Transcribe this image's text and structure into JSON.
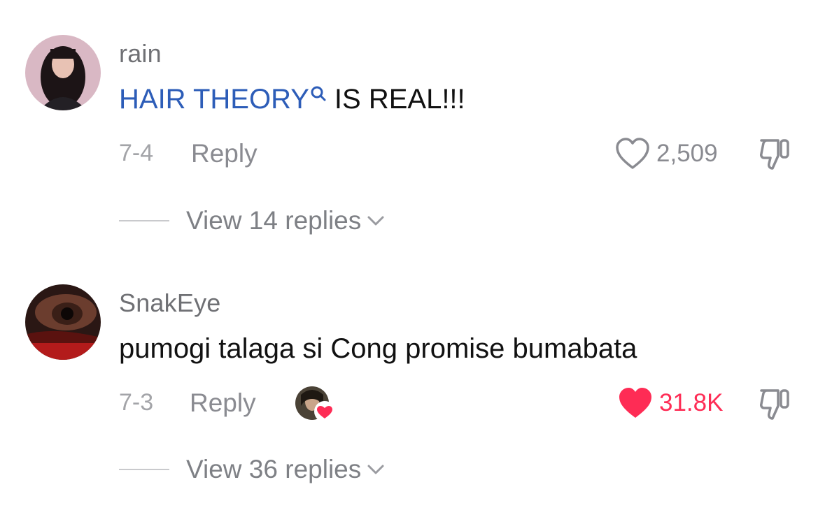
{
  "comments": [
    {
      "username": "rain",
      "hashtag": "HAIR THEORY",
      "text_rest": "IS REAL!!!",
      "date": "7-4",
      "reply_label": "Reply",
      "likes": "2,509",
      "liked": false,
      "replies_label": "View 14 replies"
    },
    {
      "username": "SnakEye",
      "text": "pumogi talaga si Cong promise bumabata",
      "date": "7-3",
      "reply_label": "Reply",
      "likes": "31.8K",
      "liked": true,
      "creator_liked": true,
      "replies_label": "View 36 replies"
    }
  ],
  "colors": {
    "like_active": "#fe2c55",
    "hashtag_link": "#2d5db8",
    "muted_text": "#8a8b91"
  },
  "icons": [
    "search-icon",
    "heart-outline-icon",
    "heart-filled-icon",
    "thumbs-down-icon",
    "chevron-down-icon"
  ]
}
